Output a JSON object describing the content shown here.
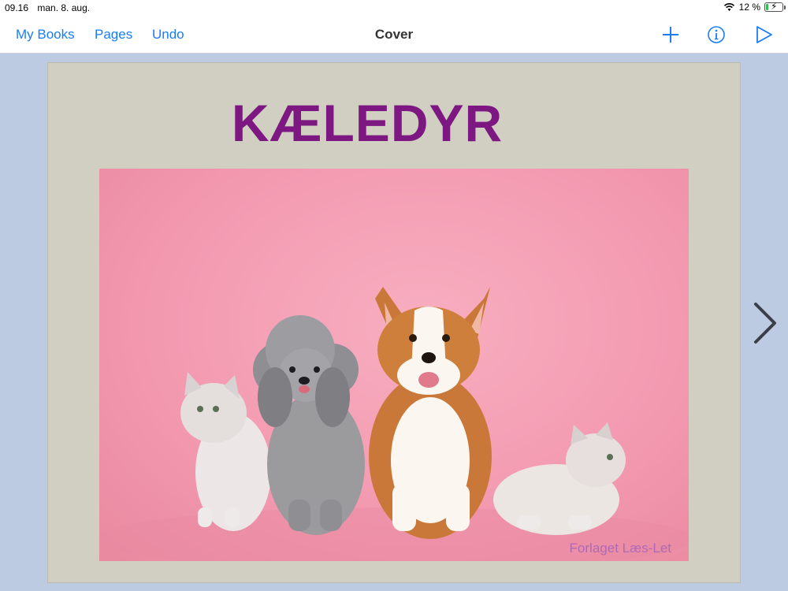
{
  "status_bar": {
    "time": "09.16",
    "date": "man. 8. aug.",
    "battery": "12 %",
    "wifi_icon": "wifi-icon",
    "battery_icon": "battery-charging-icon",
    "battery_level": 0.12
  },
  "nav": {
    "my_books": "My Books",
    "pages": "Pages",
    "undo": "Undo",
    "title": "Cover",
    "icons": [
      "plus-icon",
      "info-icon",
      "play-icon"
    ],
    "accent": "#1a7cf5"
  },
  "cover": {
    "title": "KÆLEDYR",
    "title_color": "#7d1882",
    "publisher": "Forlaget Læs-Let",
    "image": "photo of two cats, a grey poodle and a corgi on pink background"
  },
  "next_icon": "chevron-right-icon"
}
